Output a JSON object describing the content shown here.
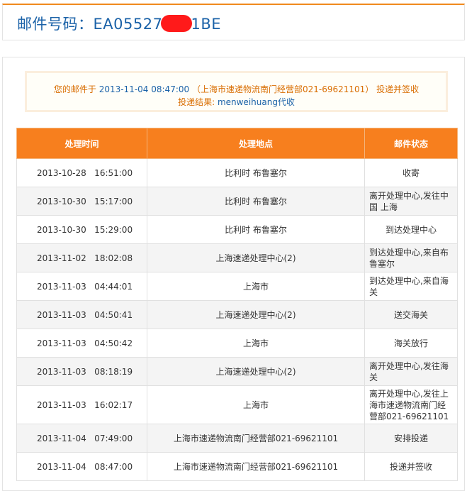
{
  "header": {
    "label": "邮件号码：",
    "number_prefix": "EA05527",
    "number_suffix": "1BE"
  },
  "notice": {
    "line1_prefix": "您的邮件于",
    "line1_time": "2013-11-04 08:47:00",
    "line1_location": "（上海市速递物流南门经营部021-69621101）",
    "line1_status": "投递并签收",
    "line2_label": "投递结果:",
    "line2_value": "menweihuang代收"
  },
  "table": {
    "headers": [
      "处理时间",
      "处理地点",
      "邮件状态"
    ],
    "rows": [
      {
        "time": "2013-10-28   16:51:00",
        "place": "比利时 布鲁塞尔",
        "status": "收寄"
      },
      {
        "time": "2013-10-30   15:17:00",
        "place": "比利时 布鲁塞尔",
        "status": "离开处理中心,发往中国 上海"
      },
      {
        "time": "2013-10-30   15:29:00",
        "place": "比利时 布鲁塞尔",
        "status": "到达处理中心"
      },
      {
        "time": "2013-11-02   18:02:08",
        "place": "上海速递处理中心(2)",
        "status": "到达处理中心,来自布鲁塞尔"
      },
      {
        "time": "2013-11-03   04:44:01",
        "place": "上海市",
        "status": "到达处理中心,来自海关"
      },
      {
        "time": "2013-11-03   04:50:41",
        "place": "上海速递处理中心(2)",
        "status": "送交海关"
      },
      {
        "time": "2013-11-03   04:50:42",
        "place": "上海市",
        "status": "海关放行"
      },
      {
        "time": "2013-11-03   08:18:19",
        "place": "上海速递处理中心(2)",
        "status": "离开处理中心,发往海关"
      },
      {
        "time": "2013-11-03   16:02:17",
        "place": "上海市",
        "status": "离开处理中心,发往上海市速递物流南门经营部021-69621101"
      },
      {
        "time": "2013-11-04   07:49:00",
        "place": "上海市速递物流南门经营部021-69621101",
        "status": "安排投递"
      },
      {
        "time": "2013-11-04   08:47:00",
        "place": "上海市速递物流南门经营部021-69621101",
        "status": "投递并签收"
      }
    ]
  },
  "colors": {
    "accent_orange": "#f77f1e",
    "title_blue": "#1b62a8",
    "notice_text": "#d96d00",
    "redaction": "#ff1a1a"
  }
}
